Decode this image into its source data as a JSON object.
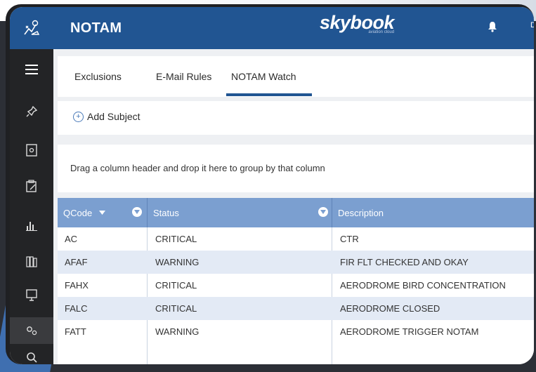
{
  "header": {
    "app_title": "NOTAM",
    "brand_name": "skybook",
    "brand_sub": "aviation cloud",
    "edge_letter": "D"
  },
  "sidebar": {
    "items": [
      {
        "icon": "menu-icon"
      },
      {
        "icon": "pin-icon"
      },
      {
        "icon": "document-icon"
      },
      {
        "icon": "clipboard-icon"
      },
      {
        "icon": "chart-icon"
      },
      {
        "icon": "library-icon"
      },
      {
        "icon": "monitor-icon"
      },
      {
        "icon": "settings-icon"
      },
      {
        "icon": "search-icon"
      }
    ]
  },
  "tabs": [
    {
      "label": "Exclusions"
    },
    {
      "label": "E-Mail Rules"
    },
    {
      "label": "NOTAM Watch",
      "active": true
    }
  ],
  "toolbar": {
    "add_subject_label": "Add Subject"
  },
  "group_panel": {
    "hint": "Drag a column header and drop it here to group by that column"
  },
  "grid": {
    "columns": [
      {
        "label": "QCode",
        "sorted": "descending"
      },
      {
        "label": "Status"
      },
      {
        "label": "Description"
      }
    ],
    "rows": [
      {
        "qcode": "AC",
        "status": "CRITICAL",
        "description": "CTR"
      },
      {
        "qcode": "AFAF",
        "status": "WARNING",
        "description": "FIR FLT CHECKED AND OKAY"
      },
      {
        "qcode": "FAHX",
        "status": "CRITICAL",
        "description": "AERODROME BIRD CONCENTRATION"
      },
      {
        "qcode": "FALC",
        "status": "CRITICAL",
        "description": "AERODROME CLOSED"
      },
      {
        "qcode": "FATT",
        "status": "WARNING",
        "description": "AERODROME TRIGGER NOTAM"
      }
    ]
  },
  "colors": {
    "header_bg": "#215592",
    "sidebar_bg": "#232426",
    "grid_header_bg": "#7b9fd0",
    "alt_row_bg": "#e3eaf5",
    "accent": "#215592"
  }
}
